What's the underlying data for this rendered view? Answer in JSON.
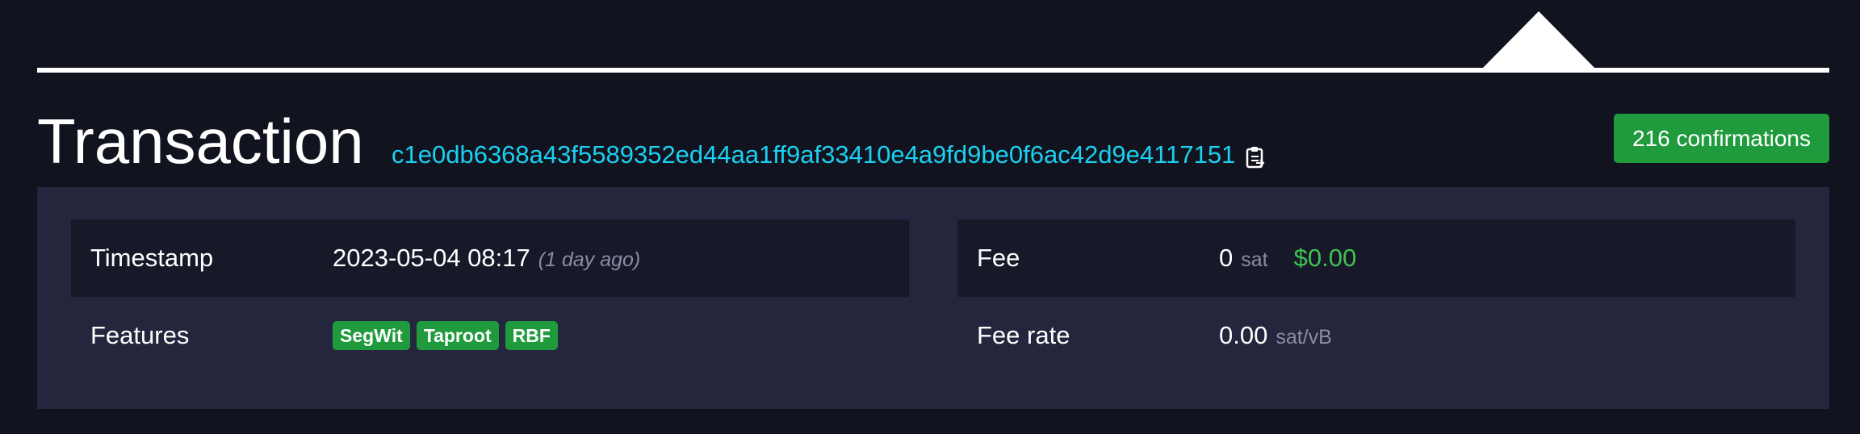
{
  "header": {
    "title": "Transaction",
    "txid": "c1e0db6368a43f5589352ed44aa1ff9af33410e4a9fd9be0f6ac42d9e4117151",
    "confirmations": "216 confirmations"
  },
  "details": {
    "timestamp_label": "Timestamp",
    "timestamp_value": "2023-05-04 08:17",
    "timestamp_relative": "(1 day ago)",
    "features_label": "Features",
    "features": [
      "SegWit",
      "Taproot",
      "RBF"
    ],
    "fee_label": "Fee",
    "fee_value": "0",
    "fee_unit": "sat",
    "fee_usd": "$0.00",
    "fee_rate_label": "Fee rate",
    "fee_rate_value": "0.00",
    "fee_rate_unit": "sat/vB"
  },
  "icons": {
    "copy": "clipboard-icon"
  },
  "colors": {
    "background": "#11131f",
    "panel": "#24263d",
    "txid": "#1bd0f0",
    "badge_green": "#1f9a3c",
    "usd_green": "#3fc24f"
  }
}
